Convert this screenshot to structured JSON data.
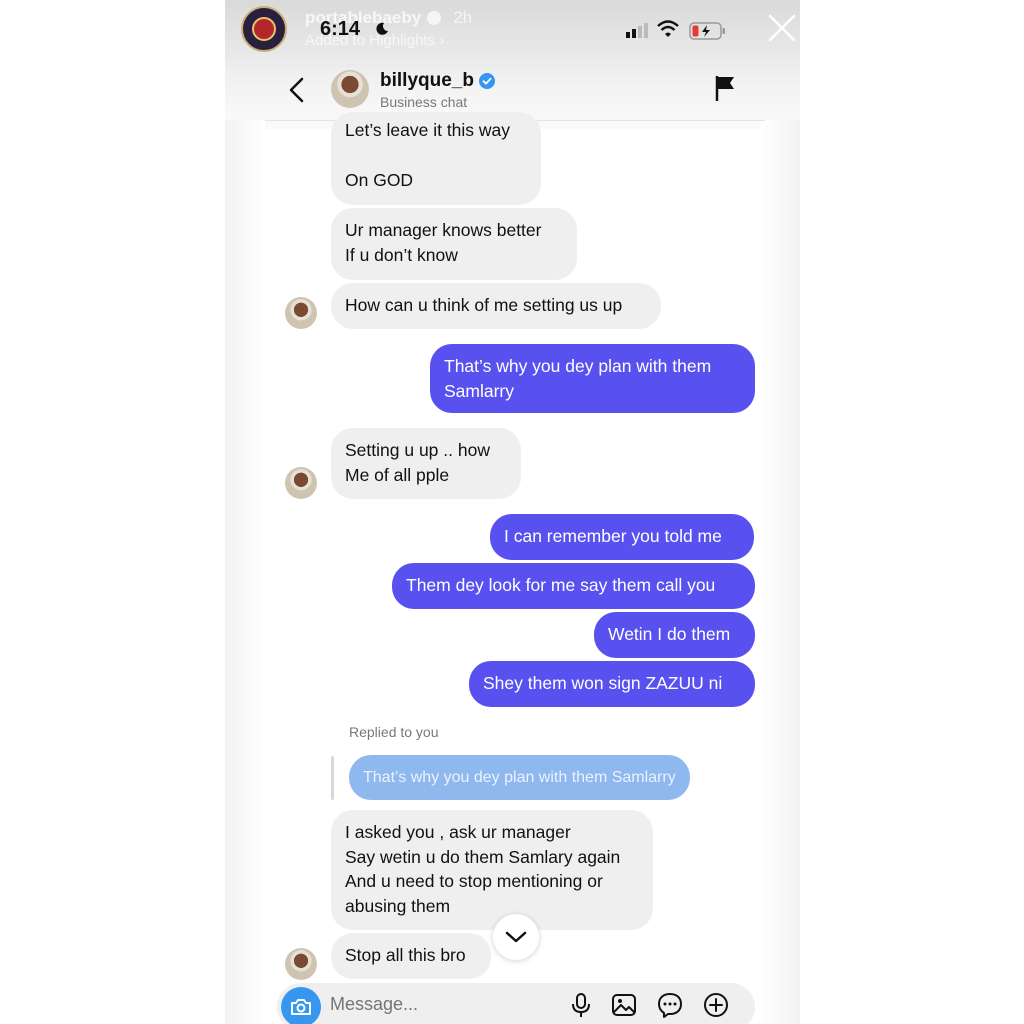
{
  "story": {
    "username": "portablebaeby",
    "time_ago": "2h",
    "subtitle": "Added to Highlights ›"
  },
  "status_bar": {
    "time": "6:14"
  },
  "chat_header": {
    "name": "billyque_b",
    "subtitle": "Business chat",
    "icons": [
      "back-icon",
      "verified-icon",
      "flag-icon"
    ]
  },
  "messages": [
    {
      "dir": "in",
      "text": "Let’s leave it this way\n\nOn GOD"
    },
    {
      "dir": "in",
      "text": "Ur manager knows better\nIf u don’t know"
    },
    {
      "dir": "in",
      "text": "How can u think of me setting us up"
    },
    {
      "dir": "out",
      "text": "That’s why you dey plan with them\nSamlarry"
    },
    {
      "dir": "in",
      "text": "Setting u up .. how\nMe of all pple"
    },
    {
      "dir": "out",
      "text": "I can remember you told me"
    },
    {
      "dir": "out",
      "text": "Them dey look for me say them call you"
    },
    {
      "dir": "out",
      "text": "Wetin I do them"
    },
    {
      "dir": "out",
      "text": "Shey them won sign ZAZUU ni"
    },
    {
      "dir": "in",
      "text": "I asked you , ask ur manager\nSay wetin u do them Samlary again\nAnd u need to stop mentioning or\nabusing them"
    },
    {
      "dir": "in",
      "text": "Stop all this bro"
    }
  ],
  "reply": {
    "label": "Replied to you",
    "quoted": "That’s why you dey plan with them Samlarry"
  },
  "composer": {
    "placeholder": "Message...",
    "icons": [
      "camera-icon",
      "microphone-icon",
      "gallery-icon",
      "sticker-icon",
      "plus-icon"
    ]
  },
  "colors": {
    "outgoing_bubble": "#5851f0",
    "incoming_bubble": "#efefef",
    "reply_quote": "#8fb8ee",
    "camera_button": "#3797f0",
    "verified": "#3797f0"
  }
}
